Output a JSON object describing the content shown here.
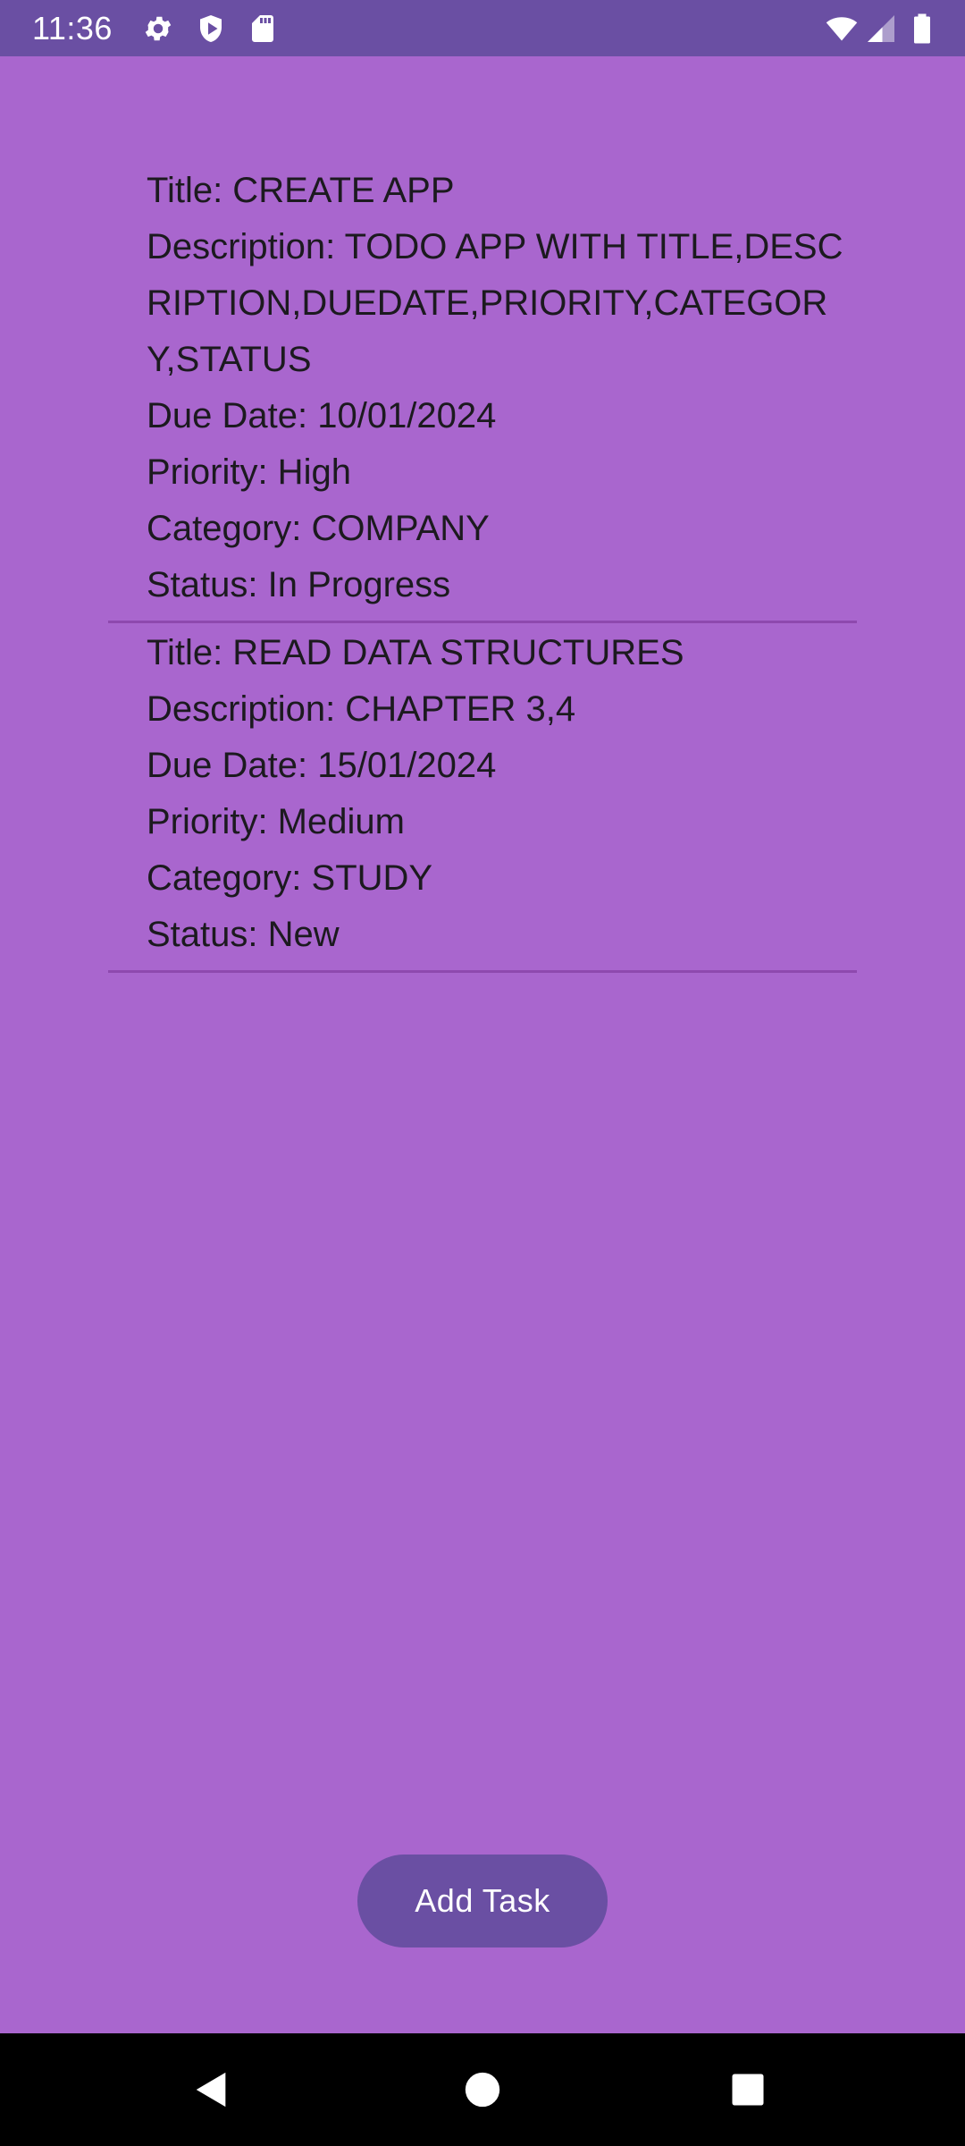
{
  "status_bar": {
    "time": "11:36",
    "icons": [
      "gear-icon",
      "shield-play-icon",
      "sd-card-icon",
      "wifi-icon",
      "signal-icon",
      "battery-icon"
    ]
  },
  "tasks": [
    {
      "title": "Title: CREATE APP",
      "description": "Description: TODO APP WITH TITLE,DESCRIPTION,DUEDATE,PRIORITY,CATEGORY,STATUS",
      "due_date": "Due Date: 10/01/2024",
      "priority": "Priority: High",
      "category": "Category: COMPANY",
      "status": "Status: In Progress"
    },
    {
      "title": "Title: READ DATA STRUCTURES",
      "description": "Description: CHAPTER 3,4",
      "due_date": "Due Date: 15/01/2024",
      "priority": "Priority: Medium",
      "category": "Category: STUDY",
      "status": "Status: New"
    }
  ],
  "add_task_button": {
    "label": "Add Task"
  },
  "nav_bar": {
    "icons": [
      "back-icon",
      "home-icon",
      "recents-icon"
    ]
  },
  "colors": {
    "background": "#A966CE",
    "status_bar": "#6A4FA3",
    "button": "#6A4FA3",
    "divider": "#8E49AE",
    "text": "#1C1A1F"
  }
}
